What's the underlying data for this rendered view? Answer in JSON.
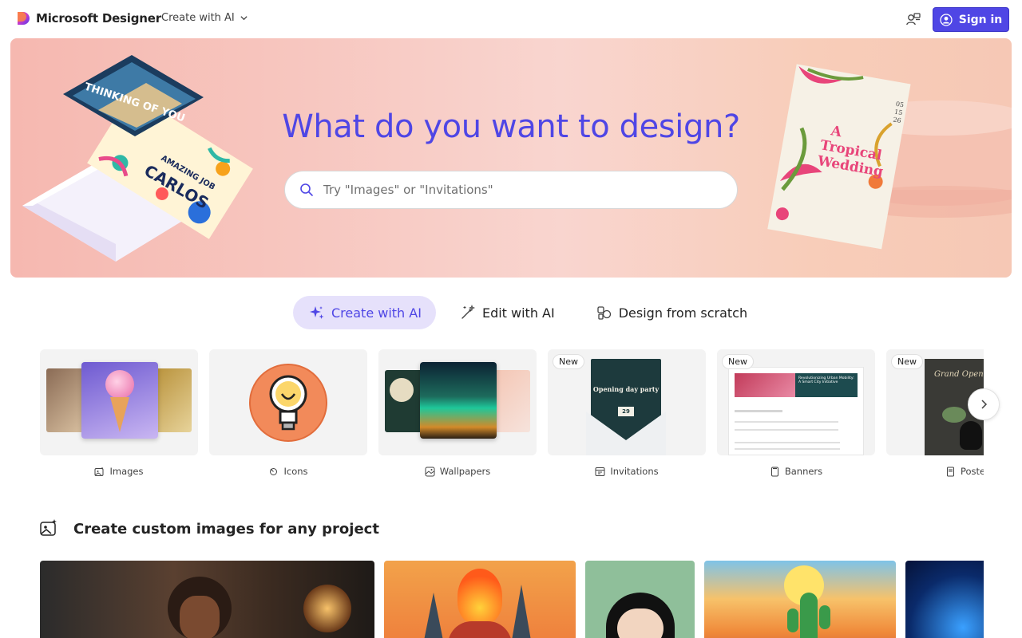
{
  "header": {
    "brand": "Microsoft Designer",
    "create_menu_label": "Create with AI",
    "signin_label": "Sign in"
  },
  "hero": {
    "title": "What do you want to design?",
    "search_placeholder": "Try \"Images\" or \"Invitations\"",
    "card_thinking_text": "THINKING OF YOU",
    "card_amazing_text": "AMAZING JOB",
    "card_carlos_text": "CARLOS",
    "wedding_title_line1": "A",
    "wedding_title_line2": "Tropical",
    "wedding_title_line3": "Wedding",
    "wedding_date": [
      "05",
      "15",
      "26"
    ]
  },
  "tabs": [
    {
      "label": "Create with AI",
      "icon": "sparkle-icon",
      "active": true
    },
    {
      "label": "Edit with AI",
      "icon": "magic-wand-icon",
      "active": false
    },
    {
      "label": "Design from scratch",
      "icon": "shapes-icon",
      "active": false
    }
  ],
  "categories": [
    {
      "label": "Images",
      "icon": "image-sparkle-icon",
      "badge": ""
    },
    {
      "label": "Icons",
      "icon": "icon-shapes-icon",
      "badge": ""
    },
    {
      "label": "Wallpapers",
      "icon": "wallpaper-icon",
      "badge": ""
    },
    {
      "label": "Invitations",
      "icon": "calendar-icon",
      "badge": "New",
      "card_title": "Opening day party",
      "card_date": "29"
    },
    {
      "label": "Banners",
      "icon": "banner-icon",
      "badge": "New",
      "card_heading": "Revolutionizing Urban Mobility: A Smart City Initiative"
    },
    {
      "label": "Posters",
      "icon": "poster-icon",
      "badge": "New",
      "card_title": "Grand Opening"
    }
  ],
  "section": {
    "title": "Create custom images for any project",
    "icon": "image-sparkle-icon"
  },
  "colors": {
    "accent": "#4f46e5",
    "accent_soft": "#e6e1fb"
  }
}
